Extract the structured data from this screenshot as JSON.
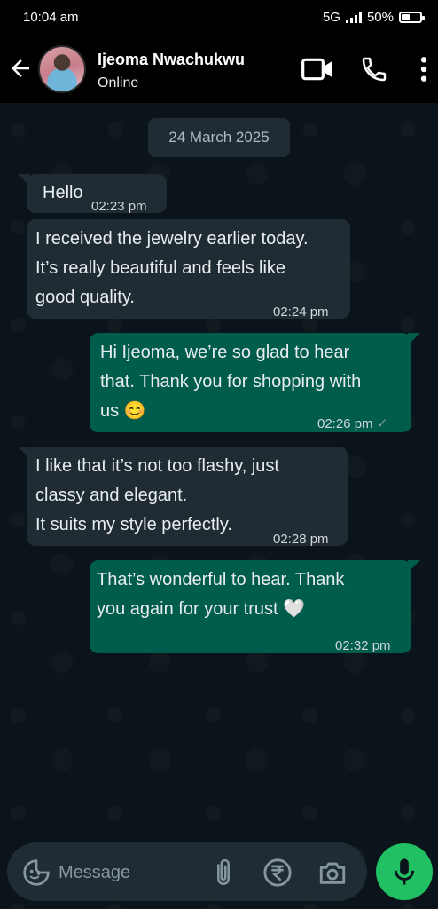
{
  "status_bar": {
    "time": "10:04 am",
    "network": "5G",
    "battery": "50%",
    "battery_level": 0.5
  },
  "header": {
    "contact_name": "Ijeoma Nwachukwu",
    "contact_status": "Online"
  },
  "chat": {
    "date": "24 March 2025",
    "messages": [
      {
        "direction": "incoming",
        "text": "Hello",
        "time": "02:23 pm"
      },
      {
        "direction": "incoming",
        "text": "I received the jewelry earlier today.\nIt’s really beautiful and feels like\ngood quality.",
        "time": "02:24 pm"
      },
      {
        "direction": "outgoing",
        "text": "Hi Ijeoma, we’re so glad to hear\nthat. Thank you for shopping with\nus 😊",
        "time": "02:26 pm",
        "status": "✓"
      },
      {
        "direction": "incoming",
        "text": "I like that it’s not too flashy, just\nclassy and elegant.\nIt suits my style perfectly.",
        "time": "02:28 pm"
      },
      {
        "direction": "outgoing",
        "text": "That’s wonderful to hear. Thank\nyou again for your trust 🤍",
        "time": "02:32 pm"
      }
    ]
  },
  "composer": {
    "placeholder": "Message"
  },
  "icons": [
    "back-arrow-icon",
    "video-call-icon",
    "phone-icon",
    "more-options-icon",
    "emoji-sticker-icon",
    "attachment-icon",
    "rupee-payment-icon",
    "camera-icon",
    "microphone-icon"
  ],
  "colors": {
    "incoming_bubble": "#202c33",
    "outgoing_bubble": "#005c4b",
    "mic_button": "#21c063",
    "background": "#0b141a"
  }
}
